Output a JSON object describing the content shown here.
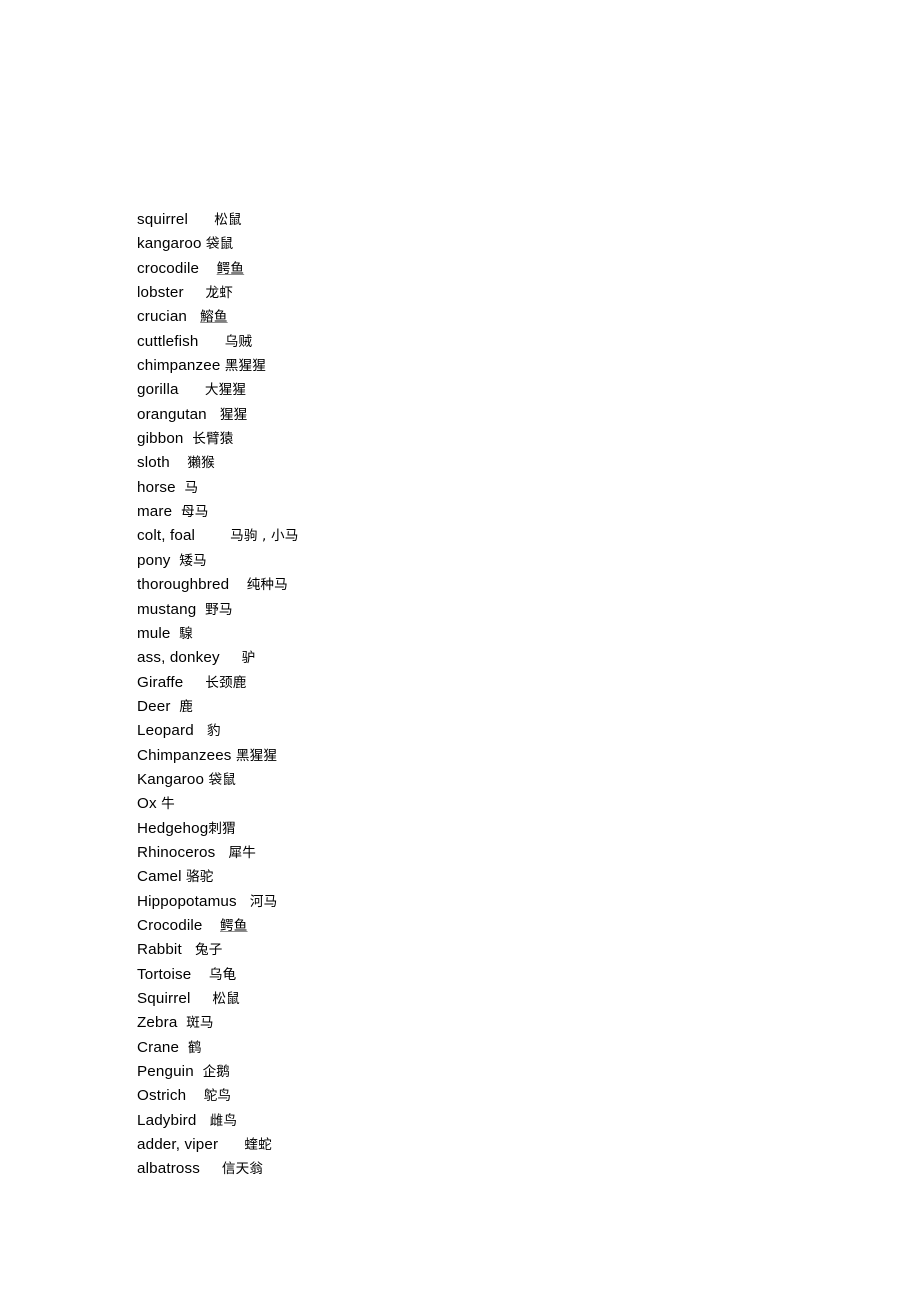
{
  "document": {
    "page_background": "#ffffff",
    "text_color": "#000000",
    "spellcheck_underline_color": "#8c8c8c",
    "lines": [
      {
        "term": "squirrel",
        "gap": "      ",
        "gloss": "松鼠",
        "misspelled": false
      },
      {
        "term": "kangaroo",
        "gap": " ",
        "gloss": "袋鼠",
        "misspelled": false
      },
      {
        "term": "crocodile",
        "gap": "    ",
        "gloss": "鳄鱼",
        "misspelled": true
      },
      {
        "term": "lobster",
        "gap": "     ",
        "gloss": "龙虾",
        "misspelled": false
      },
      {
        "term": "crucian",
        "gap": "   ",
        "gloss": "鰫鱼",
        "misspelled": true
      },
      {
        "term": "cuttlefish",
        "gap": "      ",
        "gloss": "乌贼",
        "misspelled": false
      },
      {
        "term": "chimpanzee",
        "gap": " ",
        "gloss": "黑猩猩",
        "misspelled": false
      },
      {
        "term": "gorilla",
        "gap": "      ",
        "gloss": "大猩猩",
        "misspelled": false
      },
      {
        "term": "orangutan",
        "gap": "   ",
        "gloss": "猩猩",
        "misspelled": false
      },
      {
        "term": "gibbon",
        "gap": "  ",
        "gloss": "长臂猿",
        "misspelled": false
      },
      {
        "term": "sloth",
        "gap": "    ",
        "gloss": "獺猴",
        "misspelled": false
      },
      {
        "term": "horse",
        "gap": "  ",
        "gloss": "马",
        "misspelled": false
      },
      {
        "term": "mare",
        "gap": "  ",
        "gloss": "母马",
        "misspelled": false
      },
      {
        "term": "colt, foal",
        "gap": "        ",
        "gloss": "马驹 , 小马",
        "misspelled": false
      },
      {
        "term": "pony",
        "gap": "  ",
        "gloss": "矮马",
        "misspelled": false
      },
      {
        "term": "thoroughbred",
        "gap": "    ",
        "gloss": "纯种马",
        "misspelled": false
      },
      {
        "term": "mustang",
        "gap": "  ",
        "gloss": "野马",
        "misspelled": false
      },
      {
        "term": "mule",
        "gap": "  ",
        "gloss": "騡",
        "misspelled": false
      },
      {
        "term": "ass, donkey",
        "gap": "     ",
        "gloss": "驴",
        "misspelled": false
      },
      {
        "term": "Giraffe",
        "gap": "     ",
        "gloss": "长颈鹿",
        "misspelled": false
      },
      {
        "term": "Deer",
        "gap": "  ",
        "gloss": "鹿",
        "misspelled": false
      },
      {
        "term": "Leopard",
        "gap": "   ",
        "gloss": "豹",
        "misspelled": false
      },
      {
        "term": "Chimpanzees",
        "gap": " ",
        "gloss": "黑猩猩",
        "misspelled": false
      },
      {
        "term": "Kangaroo",
        "gap": " ",
        "gloss": "袋鼠",
        "misspelled": false
      },
      {
        "term": "Ox",
        "gap": " ",
        "gloss": "牛",
        "misspelled": false
      },
      {
        "term": "Hedgehog",
        "gap": "",
        "gloss": "刺猬",
        "misspelled": false
      },
      {
        "term": "Rhinoceros",
        "gap": "   ",
        "gloss": "犀牛",
        "misspelled": false
      },
      {
        "term": "Camel",
        "gap": " ",
        "gloss": "骆驼",
        "misspelled": false
      },
      {
        "term": "Hippopotamus",
        "gap": "   ",
        "gloss": "河马",
        "misspelled": false
      },
      {
        "term": "Crocodile",
        "gap": "    ",
        "gloss": "鳄鱼",
        "misspelled": true
      },
      {
        "term": "Rabbit",
        "gap": "   ",
        "gloss": "兔子",
        "misspelled": false
      },
      {
        "term": "Tortoise",
        "gap": "    ",
        "gloss": "乌龟",
        "misspelled": false
      },
      {
        "term": "Squirrel",
        "gap": "     ",
        "gloss": "松鼠",
        "misspelled": false
      },
      {
        "term": "Zebra",
        "gap": "  ",
        "gloss": "斑马",
        "misspelled": false
      },
      {
        "term": "Crane",
        "gap": "  ",
        "gloss": "鹤",
        "misspelled": false
      },
      {
        "term": "Penguin",
        "gap": "  ",
        "gloss": "企鹅",
        "misspelled": false
      },
      {
        "term": "Ostrich",
        "gap": "    ",
        "gloss": "鸵鸟",
        "misspelled": false
      },
      {
        "term": "Ladybird",
        "gap": "   ",
        "gloss": "雌鸟",
        "misspelled": false
      },
      {
        "term": "adder, viper",
        "gap": "      ",
        "gloss": "蝰蛇",
        "misspelled": false
      },
      {
        "term": "albatross",
        "gap": "     ",
        "gloss": "信天翁",
        "misspelled": false
      }
    ]
  }
}
